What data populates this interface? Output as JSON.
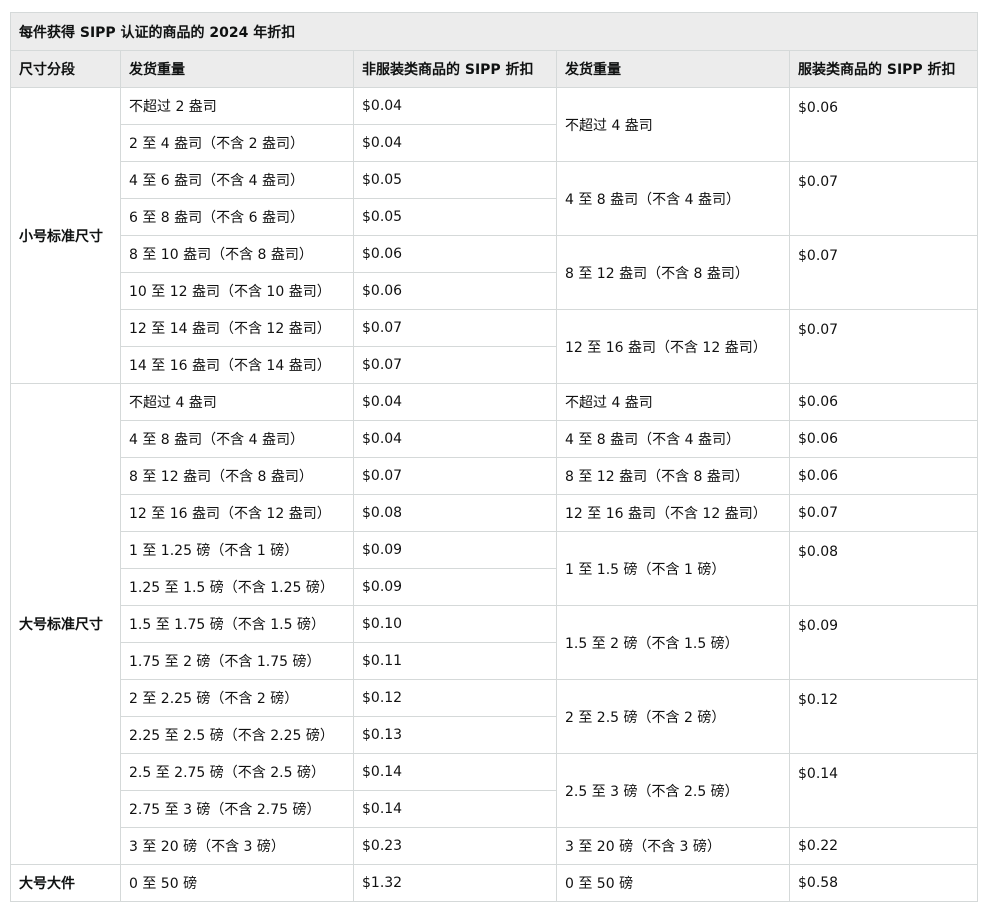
{
  "table": {
    "title": "每件获得 SIPP 认证的商品的 2024 年折扣",
    "headers": {
      "size_tier": "尺寸分段",
      "weight_a": "发货重量",
      "discount_a": "非服装类商品的 SIPP 折扣",
      "weight_b": "发货重量",
      "discount_b": "服装类商品的 SIPP 折扣"
    },
    "tiers": [
      {
        "name": "小号标准尺寸"
      },
      {
        "name": "大号标准尺寸"
      },
      {
        "name": "大号大件"
      }
    ],
    "non_apparel": [
      [
        "不超过 2 盎司",
        "$0.04"
      ],
      [
        "2 至 4 盎司（不含 2 盎司）",
        "$0.04"
      ],
      [
        "4 至 6 盎司（不含 4 盎司）",
        "$0.05"
      ],
      [
        "6 至 8 盎司（不含 6 盎司）",
        "$0.05"
      ],
      [
        "8 至 10 盎司（不含 8 盎司）",
        "$0.06"
      ],
      [
        "10 至 12 盎司（不含 10 盎司）",
        "$0.06"
      ],
      [
        "12 至 14 盎司（不含 12 盎司）",
        "$0.07"
      ],
      [
        "14 至 16 盎司（不含 14 盎司）",
        "$0.07"
      ],
      [
        "不超过 4 盎司",
        "$0.04"
      ],
      [
        "4 至 8 盎司（不含 4 盎司）",
        "$0.04"
      ],
      [
        "8 至 12 盎司（不含 8 盎司）",
        "$0.07"
      ],
      [
        "12 至 16 盎司（不含 12 盎司）",
        "$0.08"
      ],
      [
        "1 至 1.25 磅（不含 1 磅）",
        "$0.09"
      ],
      [
        "1.25 至 1.5 磅（不含 1.25 磅）",
        "$0.09"
      ],
      [
        "1.5 至 1.75 磅（不含 1.5 磅）",
        "$0.10"
      ],
      [
        "1.75 至 2 磅（不含 1.75 磅）",
        "$0.11"
      ],
      [
        "2 至 2.25 磅（不含 2 磅）",
        "$0.12"
      ],
      [
        "2.25 至 2.5 磅（不含 2.25 磅）",
        "$0.13"
      ],
      [
        "2.5 至 2.75 磅（不含 2.5 磅）",
        "$0.14"
      ],
      [
        "2.75 至 3 磅（不含 2.75 磅）",
        "$0.14"
      ],
      [
        "3 至 20 磅（不含 3 磅）",
        "$0.23"
      ],
      [
        "0 至 50 磅",
        "$1.32"
      ]
    ],
    "apparel": [
      [
        "不超过 4 盎司",
        "$0.06"
      ],
      [
        "4 至 8 盎司（不含 4 盎司）",
        "$0.07"
      ],
      [
        "8 至 12 盎司（不含 8 盎司）",
        "$0.07"
      ],
      [
        "12 至 16 盎司（不含 12 盎司）",
        "$0.07"
      ],
      [
        "不超过 4 盎司",
        "$0.06"
      ],
      [
        "4 至 8 盎司（不含 4 盎司）",
        "$0.06"
      ],
      [
        "8 至 12 盎司（不含 8 盎司）",
        "$0.06"
      ],
      [
        "12 至 16 盎司（不含 12 盎司）",
        "$0.07"
      ],
      [
        "1 至 1.5 磅（不含 1 磅）",
        "$0.08"
      ],
      [
        "1.5 至 2 磅（不含 1.5 磅）",
        "$0.09"
      ],
      [
        "2 至 2.5 磅（不含 2 磅）",
        "$0.12"
      ],
      [
        "2.5 至 3 磅（不含 2.5 磅）",
        "$0.14"
      ],
      [
        "3 至 20 磅（不含 3 磅）",
        "$0.22"
      ],
      [
        "0 至 50 磅",
        "$0.58"
      ]
    ]
  }
}
